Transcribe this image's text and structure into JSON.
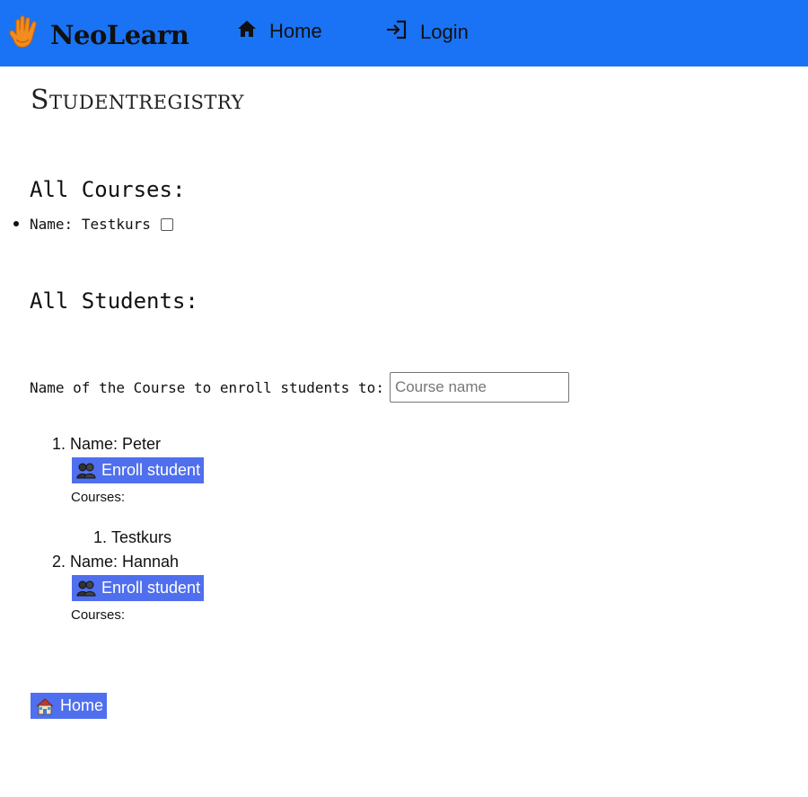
{
  "navbar": {
    "brand": "NeoLearn",
    "links": [
      {
        "label": "Home",
        "icon": "home-icon"
      },
      {
        "label": "Login",
        "icon": "login-icon"
      }
    ],
    "background": "#1a73f5"
  },
  "page_title": "Studentregistry",
  "courses_section": {
    "heading": "All Courses:",
    "items": [
      {
        "prefix": "Name:",
        "name": "Testkurs",
        "checked": false
      }
    ]
  },
  "students_section": {
    "heading": "All Students:",
    "enroll_label": "Name of the Course to enroll students to:",
    "course_input": {
      "value": "",
      "placeholder": "Course name"
    },
    "students": [
      {
        "number": "1.",
        "label": "Name: Peter",
        "button": "Enroll student",
        "courses_label": "Courses:",
        "courses": [
          {
            "number": "1.",
            "name": "Testkurs"
          }
        ]
      },
      {
        "number": "2.",
        "label": "Name: Hannah",
        "button": "Enroll student",
        "courses_label": "Courses:",
        "courses": []
      }
    ]
  },
  "footer": {
    "home_button": "Home"
  },
  "colors": {
    "button": "#4f6fee",
    "navbar": "#1a73f5"
  }
}
